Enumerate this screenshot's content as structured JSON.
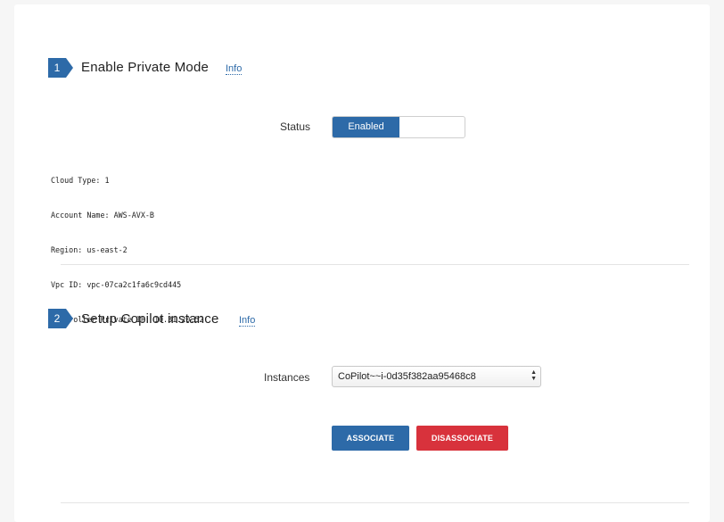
{
  "section1": {
    "step": "1",
    "title": "Enable Private Mode",
    "info_label": "Info",
    "status_label": "Status",
    "toggle_value": "Enabled",
    "details": [
      "Cloud Type: 1",
      "Account Name: AWS-AVX-B",
      "Region: us-east-2",
      "Vpc ID: vpc-07ca2c1fa6c9cd445",
      "Controller Private IP: 10.31.20.52"
    ]
  },
  "section2": {
    "step": "2",
    "title": "Setup Copilot instance",
    "info_label": "Info",
    "instances_label": "Instances",
    "instance_selected": "CoPilot~~i-0d35f382aa95468c8",
    "associate_label": "ASSOCIATE",
    "disassociate_label": "DISASSOCIATE"
  },
  "colors": {
    "accent": "#2d6aa8",
    "danger": "#d8323c"
  }
}
